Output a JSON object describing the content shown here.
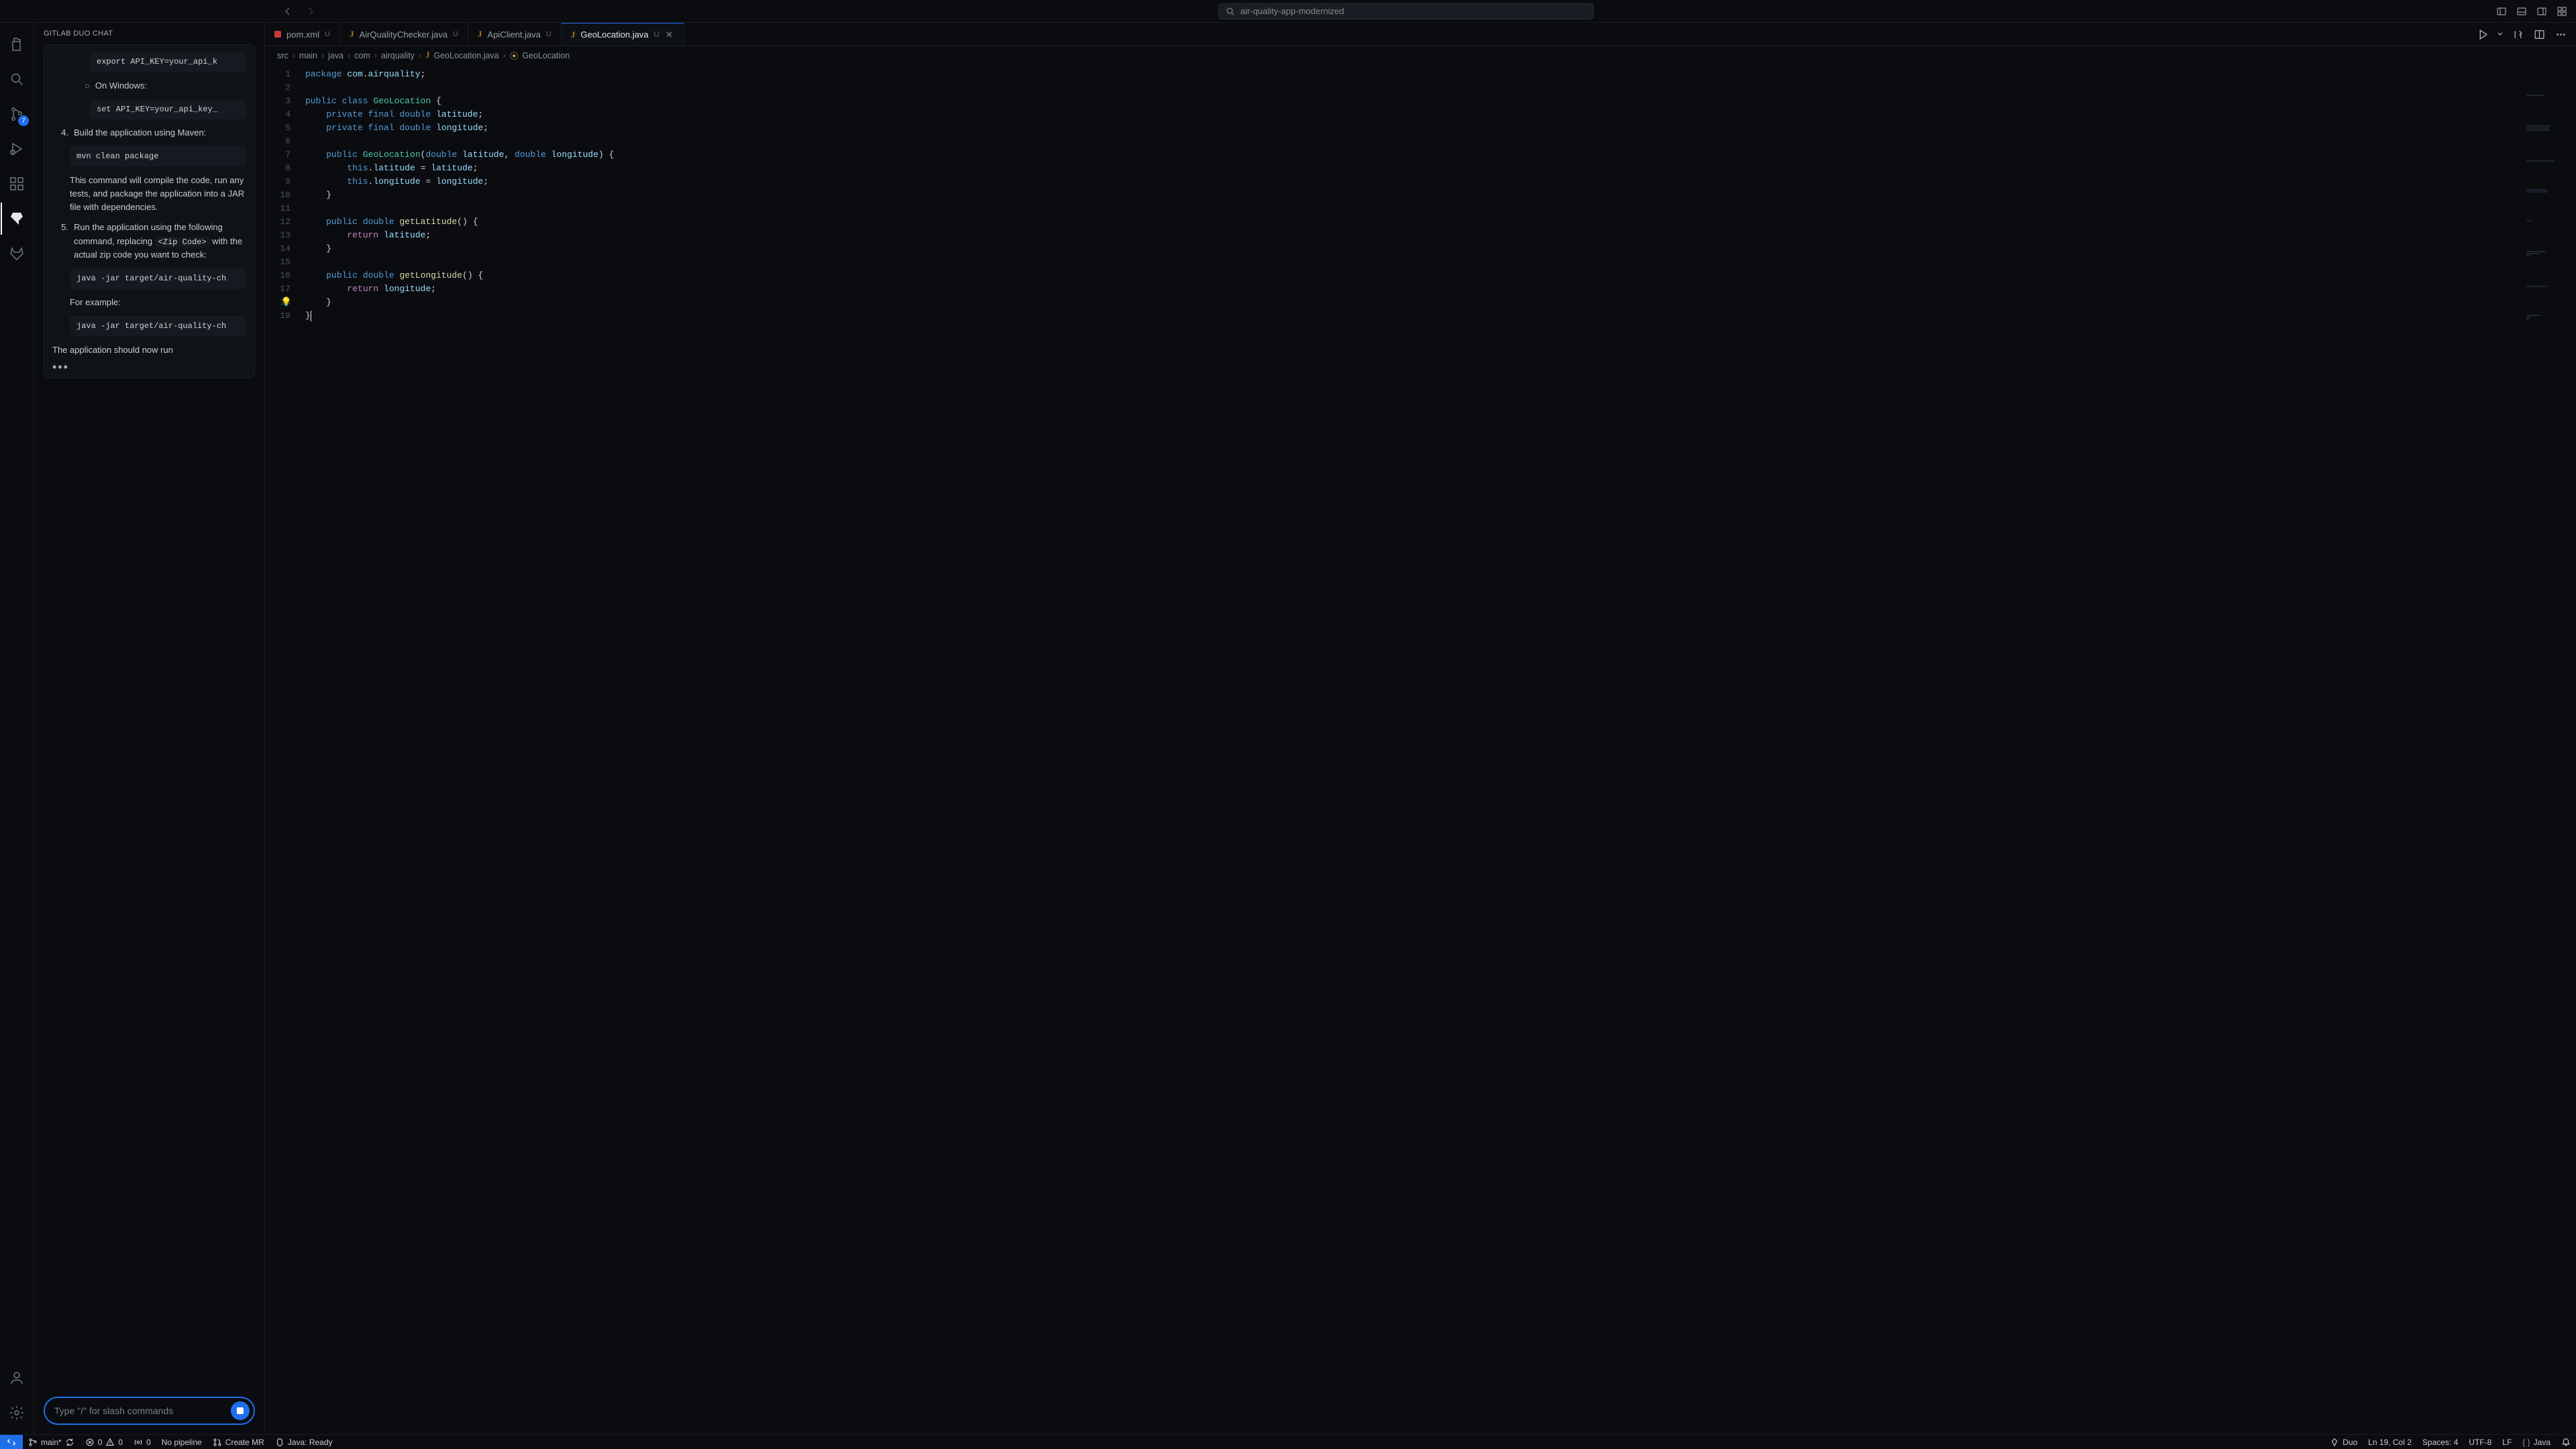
{
  "window": {
    "search_placeholder": "air-quality-app-modernized"
  },
  "activity": {
    "scm_badge": "7"
  },
  "chat": {
    "title": "GITLAB DUO CHAT",
    "snippet_export": "export API_KEY=your_api_k",
    "on_windows": "On Windows:",
    "snippet_set": "set API_KEY=your_api_key_",
    "step4_num": "4.",
    "step4": "Build the application using Maven:",
    "snippet_mvn": "mvn clean package",
    "step4_desc": "This command will compile the code, run any tests, and package the application into a JAR file with dependencies.",
    "step5_num": "5.",
    "step5_a": "Run the application using the following command, replacing ",
    "step5_code": "<Zip Code>",
    "step5_b": " with the actual zip code you want to check:",
    "snippet_run": "java -jar target/air-quality-ch",
    "for_example": "For example:",
    "snippet_example": "java -jar target/air-quality-ch",
    "footer": "The application should now run",
    "typing": "•••",
    "input_placeholder": "Type \"/\" for slash commands"
  },
  "tabs": [
    {
      "label": "pom.xml",
      "badge": "U",
      "icon": "pom"
    },
    {
      "label": "AirQualityChecker.java",
      "badge": "U",
      "icon": "J"
    },
    {
      "label": "ApiClient.java",
      "badge": "U",
      "icon": "J"
    },
    {
      "label": "GeoLocation.java",
      "badge": "U",
      "icon": "J",
      "active": true,
      "close": true
    }
  ],
  "breadcrumb": {
    "p1": "src",
    "p2": "main",
    "p3": "java",
    "p4": "com",
    "p5": "airquality",
    "file": "GeoLocation.java",
    "symbol": "GeoLocation"
  },
  "code": {
    "lines": 19,
    "bulb_line": 18
  },
  "status": {
    "branch": "main*",
    "errors": "0",
    "warnings": "0",
    "ports": "0",
    "pipeline": "No pipeline",
    "create_mr": "Create MR",
    "java_ready": "Java: Ready",
    "duo": "Duo",
    "ln_col": "Ln 19, Col 2",
    "spaces": "Spaces: 4",
    "encoding": "UTF-8",
    "eol": "LF",
    "lang": "Java"
  }
}
